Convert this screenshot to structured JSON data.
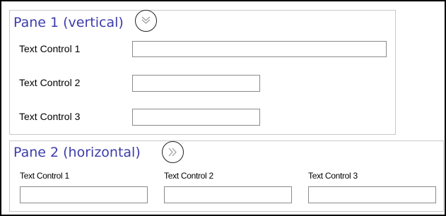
{
  "pane1": {
    "title": "Pane 1 (vertical)",
    "collapse_icon": "double-chevron-down-icon",
    "fields": [
      {
        "label": "Text Control 1",
        "value": ""
      },
      {
        "label": "Text Control 2",
        "value": ""
      },
      {
        "label": "Text Control 3",
        "value": ""
      }
    ]
  },
  "pane2": {
    "title": "Pane 2 (horizontal)",
    "collapse_icon": "double-chevron-right-icon",
    "fields": [
      {
        "label": "Text Control 1",
        "value": ""
      },
      {
        "label": "Text Control 2",
        "value": ""
      },
      {
        "label": "Text Control 3",
        "value": ""
      }
    ]
  },
  "colors": {
    "title": "#3c3caa",
    "pane_border": "#c9c9c9",
    "input_border": "#8a8a8a",
    "frame_border": "#000000"
  }
}
